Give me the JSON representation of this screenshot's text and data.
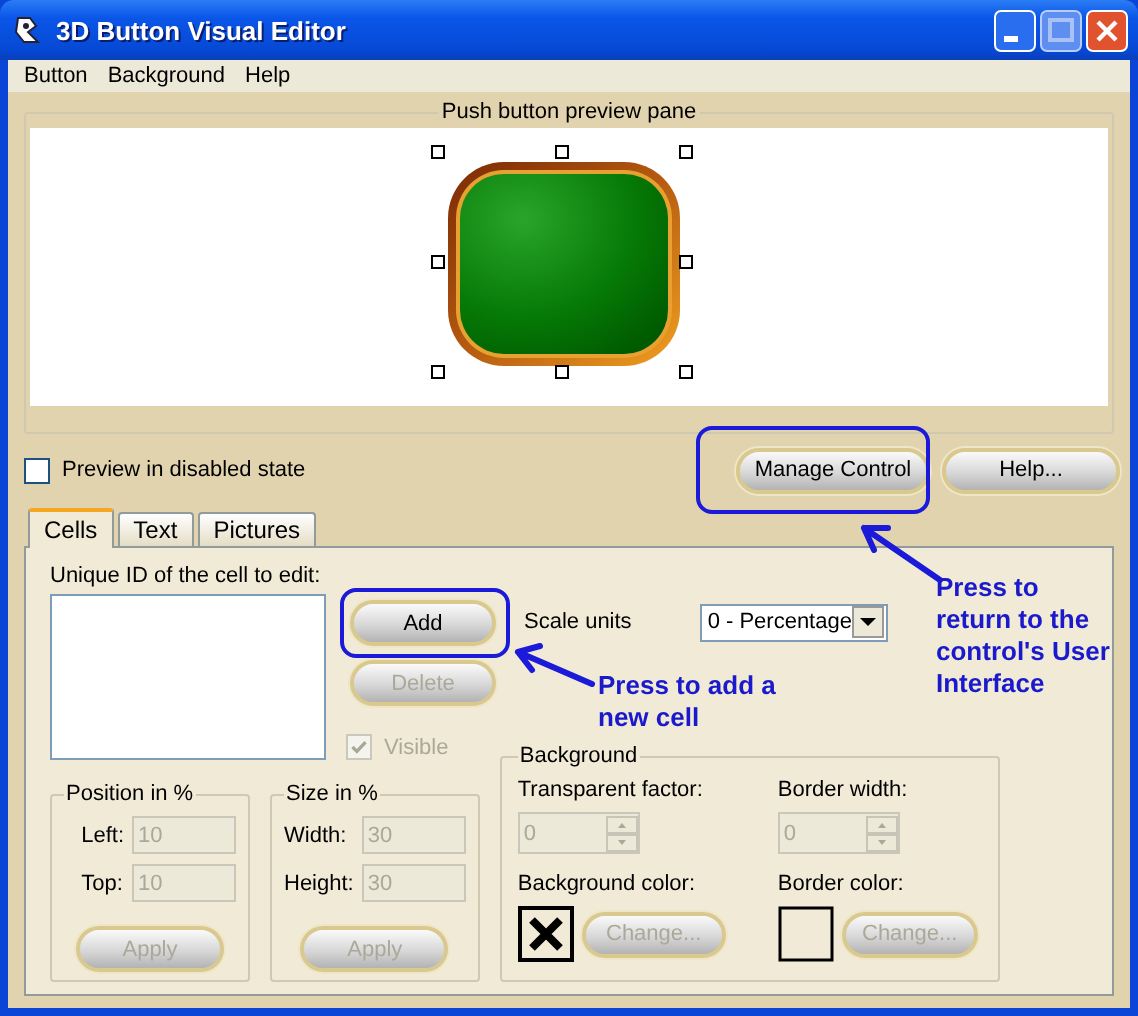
{
  "window": {
    "title": "3D Button Visual Editor"
  },
  "menu": [
    {
      "label": "Button"
    },
    {
      "label": "Background"
    },
    {
      "label": "Help"
    }
  ],
  "preview": {
    "title": "Push button preview pane"
  },
  "disabled_preview": {
    "label": "Preview in disabled state",
    "checked": false
  },
  "actions": [
    {
      "label": "Manage Control",
      "disabled": false
    },
    {
      "label": "Help...",
      "disabled": false
    }
  ],
  "tabs": [
    {
      "label": "Cells",
      "selected": true
    },
    {
      "label": "Text",
      "selected": false
    },
    {
      "label": "Pictures",
      "selected": false
    }
  ],
  "cells": {
    "list_label": "Unique ID of the cell to edit:",
    "buttons": [
      {
        "label": "Add",
        "disabled": false
      },
      {
        "label": "Delete",
        "disabled": true
      }
    ],
    "visible": {
      "label": "Visible",
      "checked": true,
      "disabled": true
    },
    "scale_units": {
      "label": "Scale units",
      "value": "0 - Percentage"
    },
    "groups": [
      {
        "title": "Position in %",
        "fields": [
          {
            "label": "Left:",
            "value": "10",
            "disabled": true
          },
          {
            "label": "Top:",
            "value": "10",
            "disabled": true
          }
        ],
        "button": {
          "label": "Apply",
          "disabled": true
        }
      },
      {
        "title": "Size in %",
        "fields": [
          {
            "label": "Width:",
            "value": "30",
            "disabled": true
          },
          {
            "label": "Height:",
            "value": "30",
            "disabled": true
          }
        ],
        "button": {
          "label": "Apply",
          "disabled": true
        }
      }
    ],
    "background": {
      "title": "Background",
      "spinners": [
        {
          "label": "Transparent factor:",
          "value": "0",
          "disabled": true
        },
        {
          "label": "Border width:",
          "value": "0",
          "disabled": true
        }
      ],
      "colors": [
        {
          "label": "Background color:",
          "kind": "none",
          "button": {
            "label": "Change...",
            "disabled": true
          }
        },
        {
          "label": "Border color:",
          "kind": "empty",
          "button": {
            "label": "Change...",
            "disabled": true
          }
        }
      ]
    }
  },
  "annotations": [
    {
      "text": "Press to return to the control's User Interface"
    },
    {
      "text": "Press to add a new cell"
    }
  ]
}
